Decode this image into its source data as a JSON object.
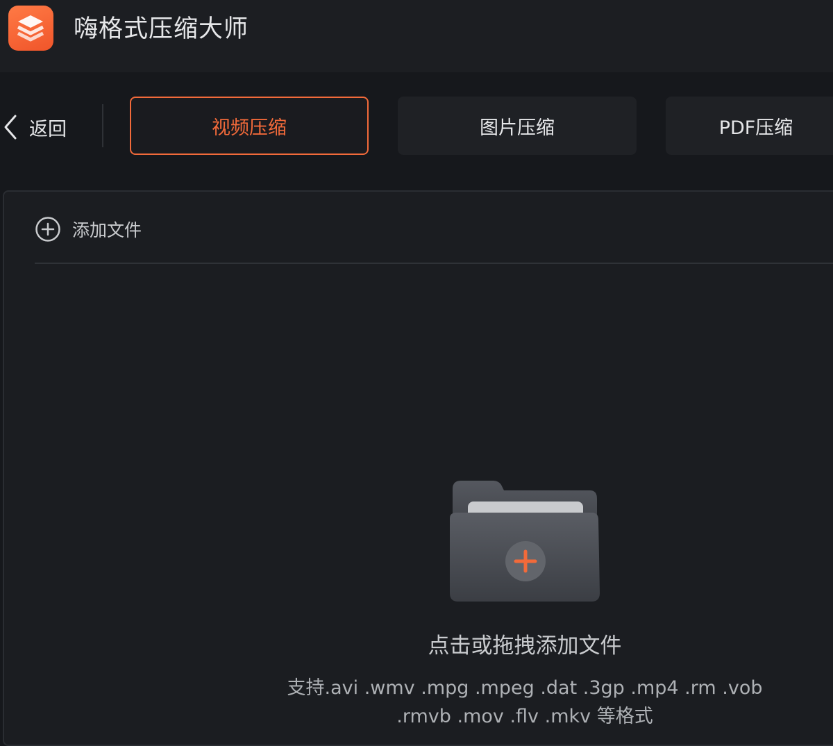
{
  "app": {
    "title": "嗨格式压缩大师",
    "accent_color": "#f26a3a"
  },
  "toolbar": {
    "back_label": "返回",
    "tabs": [
      {
        "label": "视频压缩",
        "active": true
      },
      {
        "label": "图片压缩",
        "active": false
      },
      {
        "label": "PDF压缩",
        "active": false
      }
    ]
  },
  "panel": {
    "add_file_label": "添加文件",
    "drop_title": "点击或拖拽添加文件",
    "drop_hint_line1": "支持.avi .wmv .mpg .mpeg .dat .3gp .mp4 .rm .vob",
    "drop_hint_line2": ".rmvb .mov .flv .mkv 等格式"
  },
  "icons": {
    "logo": "layers-icon",
    "back": "chevron-left-icon",
    "add_file": "plus-circle-icon",
    "drop": "folder-plus-icon"
  }
}
